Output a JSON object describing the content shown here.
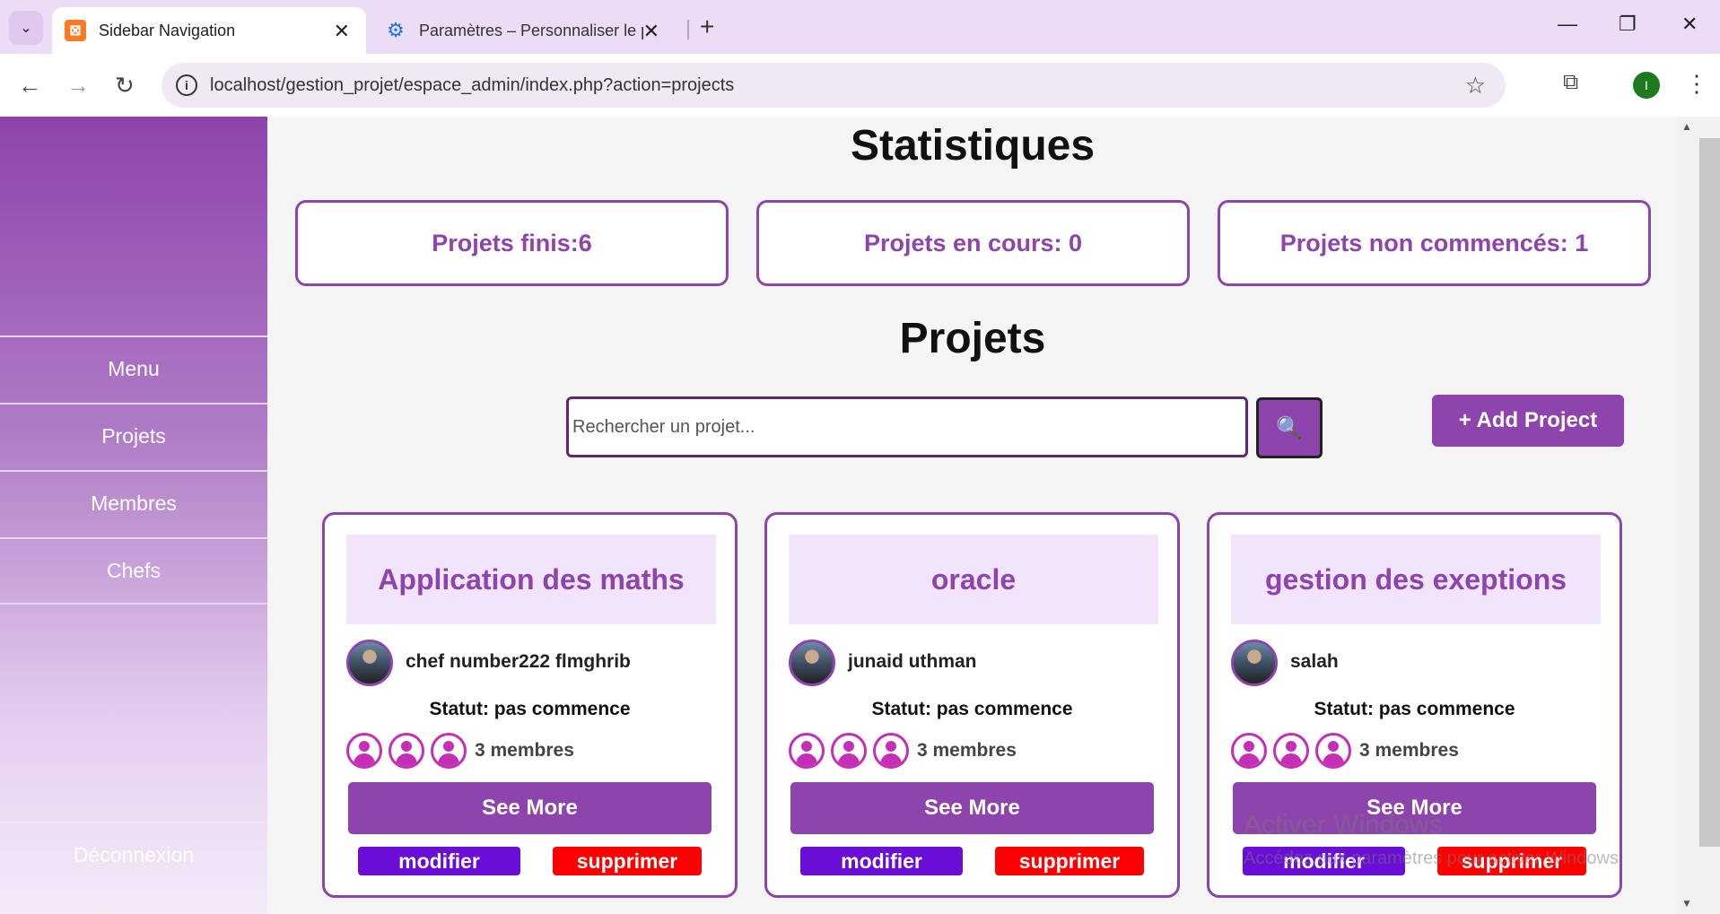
{
  "browser": {
    "tabs": [
      {
        "title": "Sidebar Navigation",
        "icon": "xampp-icon"
      },
      {
        "title": "Paramètres – Personnaliser le pr",
        "icon": "gear-icon"
      }
    ],
    "url": "localhost/gestion_projet/espace_admin/index.php?action=projects",
    "profile_initial": "I"
  },
  "sidebar": {
    "items": [
      {
        "label": "Menu"
      },
      {
        "label": "Projets"
      },
      {
        "label": "Membres"
      },
      {
        "label": "Chefs"
      }
    ],
    "logout": "Déconnexion"
  },
  "stats": {
    "heading": "Statistiques",
    "finished": "Projets finis:6",
    "in_progress": "Projets en cours: 0",
    "not_started": "Projets non commencés: 1"
  },
  "projects": {
    "heading": "Projets",
    "search_placeholder": "Rechercher un projet...",
    "search_icon": "🔍",
    "add_label": "+ Add Project",
    "cards": [
      {
        "title": "Application des maths",
        "chef": "chef number222 flmghrib",
        "status": "Statut: pas commence",
        "members": "3 membres",
        "see_more": "See More",
        "edit": "modifier",
        "delete": "supprimer"
      },
      {
        "title": "oracle",
        "chef": "junaid uthman",
        "status": "Statut: pas commence",
        "members": "3 membres",
        "see_more": "See More",
        "edit": "modifier",
        "delete": "supprimer"
      },
      {
        "title": "gestion des exeptions",
        "chef": "salah",
        "status": "Statut: pas commence",
        "members": "3 membres",
        "see_more": "See More",
        "edit": "modifier",
        "delete": "supprimer"
      }
    ]
  },
  "watermark": {
    "title": "Activer Windows",
    "subtitle": "Accédez aux paramètres pour activer Windows."
  },
  "colors": {
    "accent": "#8e44ad",
    "edit": "#6a0dd6",
    "delete": "#ff0000",
    "card_title_bg": "#f1e4fb"
  }
}
